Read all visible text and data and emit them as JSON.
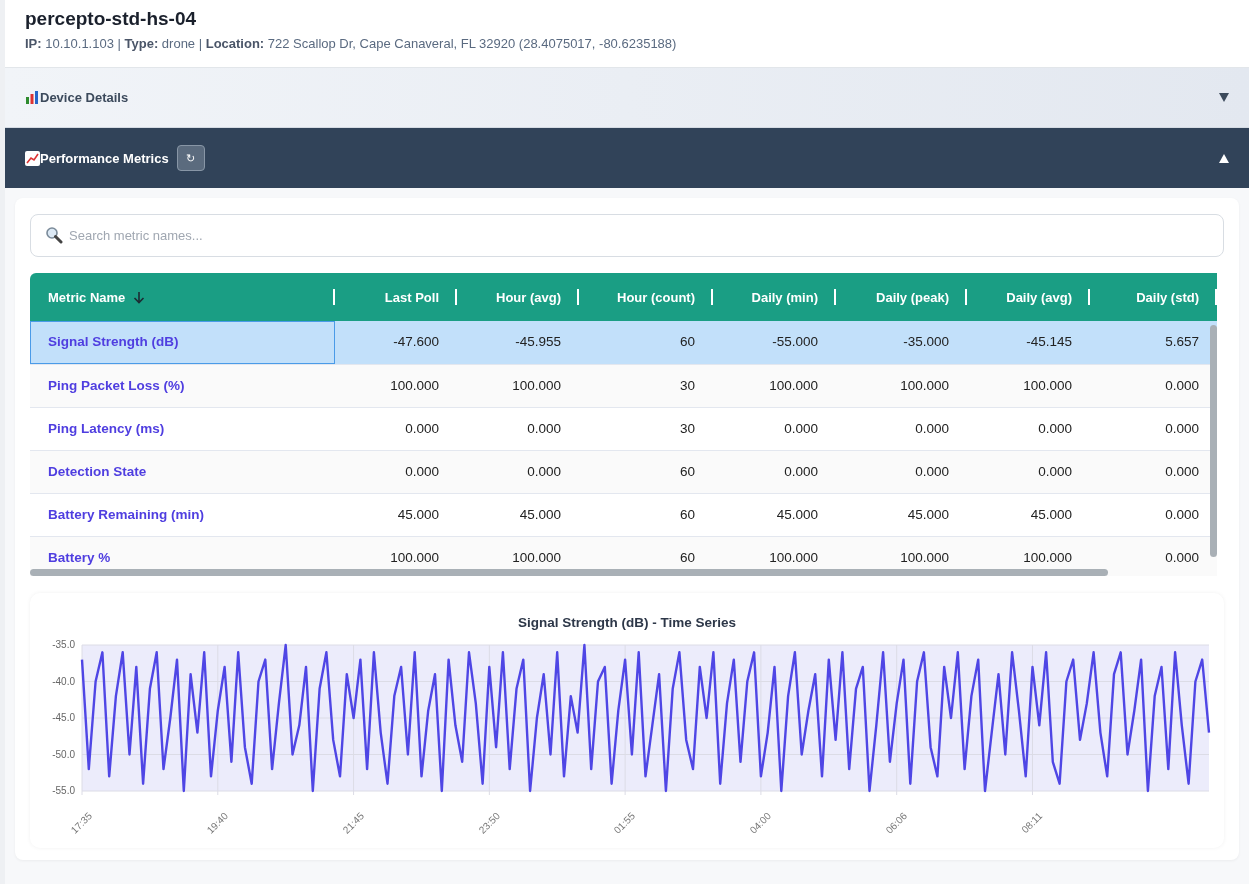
{
  "device": {
    "name": "percepto-std-hs-04",
    "info": "**IP:** 10.10.1.103 | **Type:** drone | **Location:** 722 Scallop Dr, Cape Canaveral, FL 32920 (28.4075017, -80.6235188)"
  },
  "sections": [
    {
      "title": "Device Details",
      "kind": "details",
      "expanded": false
    },
    {
      "title": "Performance Metrics",
      "kind": "metrics",
      "expanded": true,
      "refresh_label": "↻"
    }
  ],
  "search": {
    "placeholder": "Search metric names..."
  },
  "table": {
    "columns": [
      "Metric Name",
      "Last Poll",
      "Hour (avg)",
      "Hour (count)",
      "Daily (min)",
      "Daily (peak)",
      "Daily (avg)",
      "Daily (std)"
    ],
    "rows": [
      {
        "selected": true,
        "cells": [
          "Signal Strength (dB)",
          "-47.600",
          "-45.955",
          "60",
          "-55.000",
          "-35.000",
          "-45.145",
          "5.657"
        ]
      },
      {
        "selected": false,
        "cells": [
          "Ping Packet Loss (%)",
          "100.000",
          "100.000",
          "30",
          "100.000",
          "100.000",
          "100.000",
          "0.000"
        ]
      },
      {
        "selected": false,
        "cells": [
          "Ping Latency (ms)",
          "0.000",
          "0.000",
          "30",
          "0.000",
          "0.000",
          "0.000",
          "0.000"
        ]
      },
      {
        "selected": false,
        "cells": [
          "Detection State",
          "0.000",
          "0.000",
          "60",
          "0.000",
          "0.000",
          "0.000",
          "0.000"
        ]
      },
      {
        "selected": false,
        "cells": [
          "Battery Remaining (min)",
          "45.000",
          "45.000",
          "60",
          "45.000",
          "45.000",
          "45.000",
          "0.000"
        ]
      },
      {
        "selected": false,
        "cells": [
          "Battery %",
          "100.000",
          "100.000",
          "60",
          "100.000",
          "100.000",
          "100.000",
          "0.000"
        ]
      }
    ]
  },
  "time_series": {
    "chart_data": {
      "type": "line",
      "title": "Signal Strength (dB) - Time Series",
      "categories": [
        "17:35",
        null,
        null,
        null,
        null,
        null,
        null,
        null,
        null,
        null,
        null,
        null,
        null,
        null,
        null,
        null,
        null,
        null,
        null,
        null,
        "19:40",
        null,
        null,
        null,
        null,
        null,
        null,
        null,
        null,
        null,
        null,
        null,
        null,
        null,
        null,
        null,
        null,
        null,
        null,
        null,
        "21:45",
        null,
        null,
        null,
        null,
        null,
        null,
        null,
        null,
        null,
        null,
        null,
        null,
        null,
        null,
        null,
        null,
        null,
        null,
        null,
        "23:50",
        null,
        null,
        null,
        null,
        null,
        null,
        null,
        null,
        null,
        null,
        null,
        null,
        null,
        null,
        null,
        null,
        null,
        null,
        null,
        "01:55",
        null,
        null,
        null,
        null,
        null,
        null,
        null,
        null,
        null,
        null,
        null,
        null,
        null,
        null,
        null,
        null,
        null,
        null,
        null,
        "04:00",
        null,
        null,
        null,
        null,
        null,
        null,
        null,
        null,
        null,
        null,
        null,
        null,
        null,
        null,
        null,
        null,
        null,
        null,
        null,
        "06:06",
        null,
        null,
        null,
        null,
        null,
        null,
        null,
        null,
        null,
        null,
        null,
        null,
        null,
        null,
        null,
        null,
        null,
        null,
        null,
        "08:11",
        null,
        null,
        null,
        null,
        null,
        null,
        null,
        null,
        null,
        null,
        null,
        null,
        null,
        null,
        null,
        null,
        null,
        null,
        null,
        null,
        null,
        null,
        null,
        null,
        null,
        null
      ],
      "ylim": [
        -55,
        -35
      ],
      "yticks": [
        {
          "value": -35,
          "label": "-35.0"
        },
        {
          "value": -40,
          "label": "-40.0"
        },
        {
          "value": -45,
          "label": "-45.0"
        },
        {
          "value": -50,
          "label": "-50.0"
        },
        {
          "value": -55,
          "label": "-55.0"
        }
      ],
      "grid": true,
      "series": [
        {
          "color": "#4f46e5",
          "values": [
            -37,
            -52,
            -40,
            -36,
            -53,
            -42,
            -36,
            -50,
            -38,
            -54,
            -41,
            -36,
            -52,
            -45,
            -37,
            -55,
            -39,
            -47,
            -36,
            -53,
            -44,
            -38,
            -51,
            -36,
            -49,
            -54,
            -40,
            -37,
            -52,
            -43,
            -35,
            -50,
            -46,
            -38,
            -55,
            -41,
            -36,
            -48,
            -53,
            -39,
            -45,
            -37,
            -52,
            -36,
            -47,
            -54,
            -42,
            -38,
            -50,
            -36,
            -53,
            -44,
            -39,
            -55,
            -37,
            -46,
            -51,
            -36,
            -43,
            -54,
            -38,
            -49,
            -36,
            -52,
            -41,
            -37,
            -55,
            -45,
            -39,
            -50,
            -36,
            -53,
            -42,
            -47,
            -35,
            -52,
            -40,
            -38,
            -54,
            -44,
            -37,
            -50,
            -36,
            -53,
            -46,
            -39,
            -55,
            -41,
            -36,
            -48,
            -52,
            -38,
            -45,
            -36,
            -54,
            -43,
            -37,
            -51,
            -40,
            -36,
            -53,
            -47,
            -38,
            -55,
            -42,
            -36,
            -50,
            -44,
            -39,
            -53,
            -37,
            -48,
            -36,
            -52,
            -41,
            -38,
            -55,
            -46,
            -36,
            -51,
            -43,
            -37,
            -54,
            -40,
            -36,
            -49,
            -53,
            -38,
            -45,
            -36,
            -52,
            -42,
            -37,
            -55,
            -47,
            -39,
            -50,
            -36,
            -44,
            -53,
            -38,
            -46,
            -36,
            -51,
            -54,
            -40,
            -37,
            -48,
            -43,
            -36,
            -47,
            -53,
            -39,
            -36,
            -50,
            -44,
            -37,
            -55,
            -42,
            -38,
            -52,
            -36,
            -46,
            -54,
            -40,
            -37,
            -47
          ]
        }
      ]
    }
  }
}
